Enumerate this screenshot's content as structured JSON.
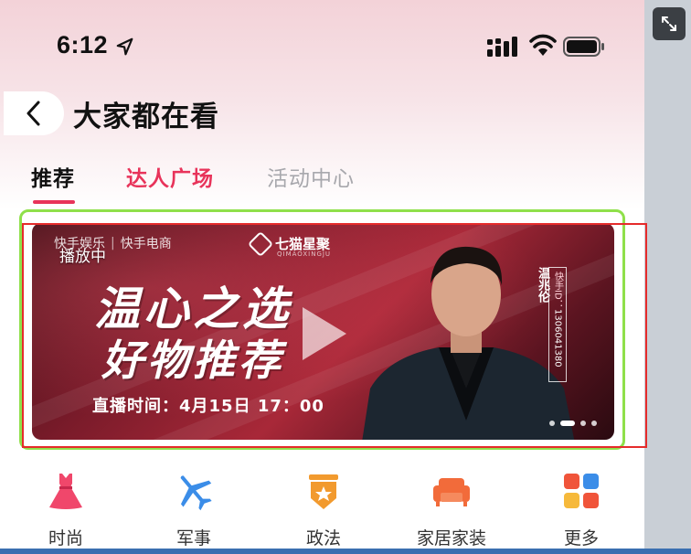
{
  "status_bar": {
    "time": "6:12",
    "icons": [
      "location-arrow-icon",
      "signal-icon",
      "wifi-icon",
      "battery-icon"
    ]
  },
  "nav": {
    "back_icon": "chevron-left-icon",
    "title": "大家都在看"
  },
  "tabs": [
    {
      "label": "推荐",
      "selected": true
    },
    {
      "label": "达人广场",
      "selected": false
    },
    {
      "label": "活动中心",
      "selected": false
    }
  ],
  "banner": {
    "brand_left_1": "快手娱乐",
    "brand_separator": "|",
    "brand_left_2": "快手电商",
    "brand_right": "七猫星聚",
    "brand_right_sub": "QIMAOXINGJU",
    "playing_label": "播放中",
    "headline_1": "温心之选",
    "headline_2": "好物推荐",
    "live_time": "直播时间：4月15日 17：00",
    "host_name": "温兆伦",
    "host_id_label": "快手ID：",
    "host_id": "1306041380",
    "carousel_count": 4,
    "carousel_active_index": 1
  },
  "categories": [
    {
      "label": "时尚",
      "icon": "dress-icon",
      "color": "#f0476b"
    },
    {
      "label": "军事",
      "icon": "airplane-icon",
      "color": "#3b8de8"
    },
    {
      "label": "政法",
      "icon": "shield-star-icon",
      "color": "#f29a2e"
    },
    {
      "label": "家居家装",
      "icon": "sofa-icon",
      "color": "#f26b3a"
    },
    {
      "label": "更多",
      "icon": "grid-icon",
      "color": "#f0543a"
    }
  ],
  "overlay": {
    "expand_icon": "expand-icon"
  },
  "colors": {
    "accent": "#e8335a",
    "highlight_green": "#8fe04a",
    "highlight_red": "#e52b2b"
  }
}
